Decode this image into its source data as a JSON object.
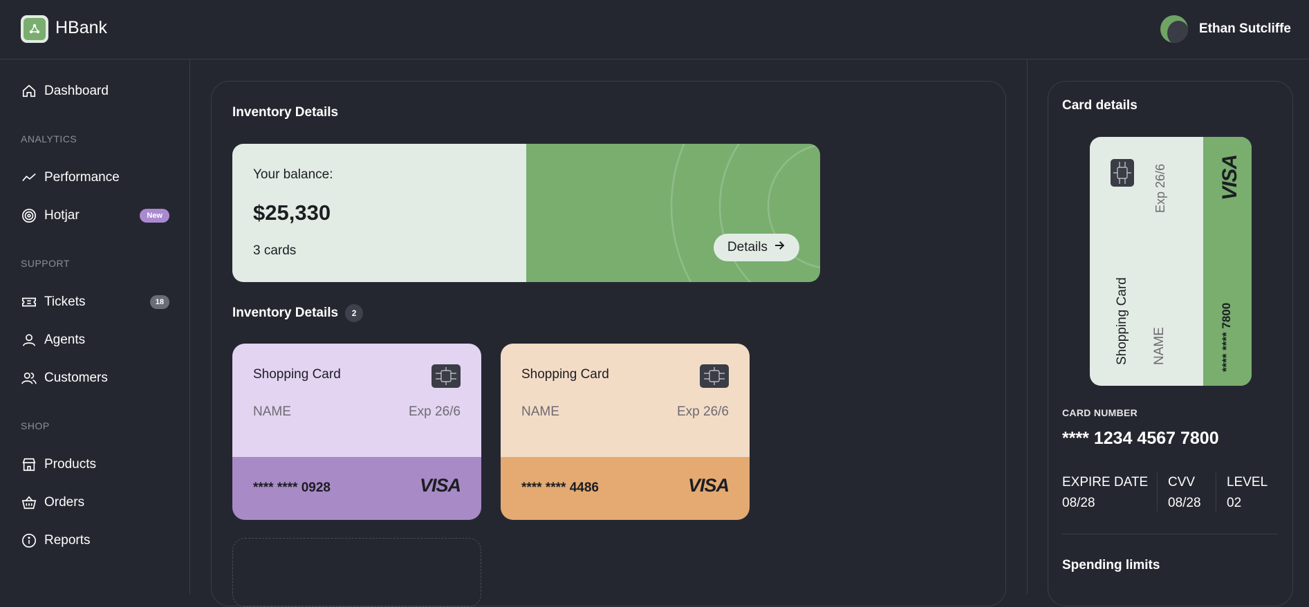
{
  "app": {
    "brand": "HBank"
  },
  "user": {
    "name": "Ethan Sutcliffe"
  },
  "sidebar": {
    "items": [
      {
        "label": "Dashboard",
        "icon": "home-icon"
      },
      {
        "label": "Performance",
        "icon": "trend-icon"
      },
      {
        "label": "Hotjar",
        "icon": "target-icon",
        "badge": "New"
      },
      {
        "label": "Tickets",
        "icon": "ticket-icon",
        "badge": "18"
      },
      {
        "label": "Agents",
        "icon": "user-icon"
      },
      {
        "label": "Customers",
        "icon": "users-icon"
      },
      {
        "label": "Products",
        "icon": "store-icon"
      },
      {
        "label": "Orders",
        "icon": "basket-icon"
      },
      {
        "label": "Reports",
        "icon": "info-icon"
      }
    ],
    "sections": {
      "analytics": "ANALYTICS",
      "support": "SUPPORT",
      "shop": "SHOP"
    }
  },
  "main": {
    "title": "Inventory Details",
    "balance": {
      "label": "Your balance:",
      "amount": "$25,330",
      "cards": "3 cards",
      "details_button": "Details"
    },
    "cards_title": "Inventory Details",
    "cards_count": "2",
    "cards": [
      {
        "title": "Shopping Card",
        "name": "NAME",
        "exp": "Exp 26/6",
        "number": "**** **** 0928",
        "brand": "VISA"
      },
      {
        "title": "Shopping Card",
        "name": "NAME",
        "exp": "Exp 26/6",
        "number": "**** **** 4486",
        "brand": "VISA"
      }
    ]
  },
  "card_details": {
    "title": "Card details",
    "preview": {
      "title": "Shopping Card",
      "name": "NAME",
      "exp": "Exp 26/6",
      "number": "**** **** 7800",
      "brand": "VISA"
    },
    "card_number_label": "CARD NUMBER",
    "card_number": "**** 1234 4567 7800",
    "expire_label": "EXPIRE DATE",
    "expire_value": "08/28",
    "cvv_label": "CVV",
    "cvv_value": "08/28",
    "level_label": "LEVEL",
    "level_value": "02",
    "spending_title": "Spending limits"
  },
  "colors": {
    "background": "#252730",
    "accent_green": "#79ae6f",
    "card_light": "#e3ece4",
    "purple_top": "#e3d4f2",
    "purple_bottom": "#a88ac6",
    "peach_top": "#f3dcc6",
    "peach_bottom": "#e4aa72",
    "badge_new": "#a98ad0"
  }
}
